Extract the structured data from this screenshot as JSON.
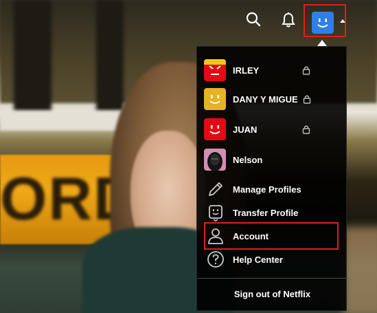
{
  "nav": {
    "search_icon": "search-icon",
    "bell_icon": "bell-icon",
    "profile_icon": "profile-avatar-smile",
    "highlight_color": "#e21d1d"
  },
  "menu": {
    "profiles": [
      {
        "name": "IRLEY",
        "avatar_color": "#e50914",
        "locked": true
      },
      {
        "name": "DANY Y MIGUE",
        "avatar_color": "#e5b323",
        "locked": true
      },
      {
        "name": "JUAN",
        "avatar_color": "#e50914",
        "locked": true
      },
      {
        "name": "Nelson",
        "avatar_color": "#d58fb0",
        "locked": false
      }
    ],
    "actions": [
      {
        "label": "Manage Profiles",
        "icon": "pencil-icon"
      },
      {
        "label": "Transfer Profile",
        "icon": "transfer-profile-icon"
      },
      {
        "label": "Account",
        "icon": "person-icon",
        "highlighted": true
      },
      {
        "label": "Help Center",
        "icon": "question-icon"
      }
    ],
    "sign_out": "Sign out of Netflix"
  }
}
